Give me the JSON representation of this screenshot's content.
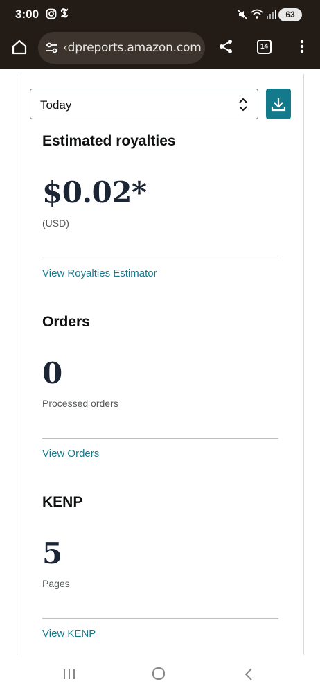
{
  "status_bar": {
    "time": "3:00",
    "battery": "63",
    "icons": [
      "instagram-icon",
      "nyt-icon",
      "mute-icon",
      "wifi-icon",
      "signal-icon",
      "battery-icon"
    ]
  },
  "browser": {
    "url": "‹dpreports.amazon.com",
    "tab_count": "14",
    "icons": [
      "home-icon",
      "site-settings-icon",
      "share-icon",
      "more-vert-icon"
    ]
  },
  "filter": {
    "selected_range": "Today"
  },
  "sections": {
    "royalties": {
      "title": "Estimated royalties",
      "value": "$0.02*",
      "sub_label": "(USD)",
      "link": "View Royalties Estimator"
    },
    "orders": {
      "title": "Orders",
      "value": "0",
      "sub_label": "Processed orders",
      "link": "View Orders"
    },
    "kenp": {
      "title": "KENP",
      "value": "5",
      "sub_label": "Pages",
      "link": "View KENP"
    }
  },
  "colors": {
    "accent": "#137a8c",
    "topbar": "#231b15",
    "text": "#0f1111",
    "value_text": "#1b2533"
  }
}
